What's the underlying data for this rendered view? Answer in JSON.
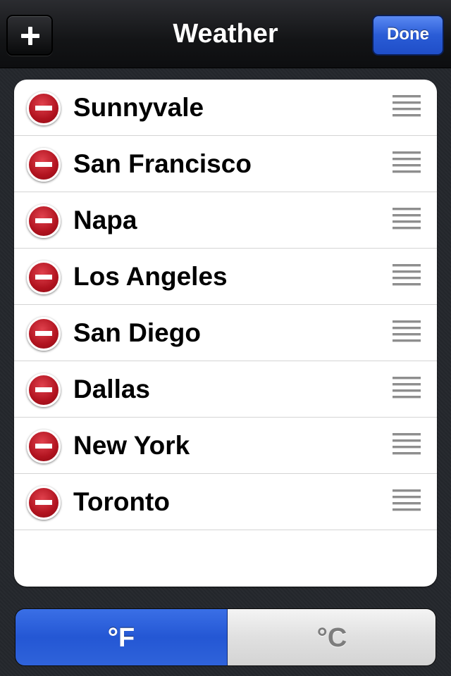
{
  "navbar": {
    "title": "Weather",
    "add_icon": "plus-icon",
    "done_label": "Done"
  },
  "cities": [
    {
      "name": "Sunnyvale"
    },
    {
      "name": "San Francisco"
    },
    {
      "name": "Napa"
    },
    {
      "name": "Los Angeles"
    },
    {
      "name": "San Diego"
    },
    {
      "name": "Dallas"
    },
    {
      "name": "New York"
    },
    {
      "name": "Toronto"
    }
  ],
  "row_icons": {
    "delete": "minus-circle-icon",
    "reorder": "reorder-grip-icon"
  },
  "units": {
    "fahrenheit_label": "°F",
    "celsius_label": "°C",
    "selected": "°F"
  },
  "colors": {
    "accent_blue": "#2a5cd6",
    "delete_red": "#b1131f",
    "background": "#24272c"
  }
}
